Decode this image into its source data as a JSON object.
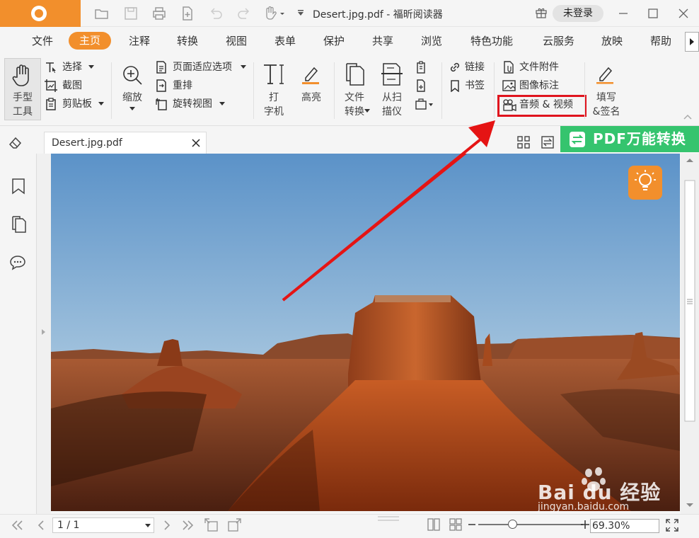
{
  "app": {
    "doc_title": "Desert.jpg.pdf - 福昕阅读器",
    "login_label": "未登录"
  },
  "menu": {
    "items": [
      "文件",
      "主页",
      "注释",
      "转换",
      "视图",
      "表单",
      "保护",
      "共享",
      "浏览",
      "特色功能",
      "云服务",
      "放映",
      "帮助"
    ],
    "active": "主页"
  },
  "ribbon": {
    "hand_tool": "手型\n工具",
    "select": "选择",
    "snapshot": "截图",
    "clipboard": "剪贴板",
    "zoom": "缩放",
    "fit_page": "页面适应选项",
    "reflow": "重排",
    "rotate_view": "旋转视图",
    "typewriter": "打\n字机",
    "highlight": "高亮",
    "file_convert": "文件\n转换",
    "from_scanner": "从扫\n描仪",
    "link": "链接",
    "bookmark": "书签",
    "file_attachment": "文件附件",
    "image_annotation": "图像标注",
    "audio_video": "音频 & 视频",
    "fill_sign": "填写\n&签名"
  },
  "tab": {
    "doc_name": "Desert.jpg.pdf"
  },
  "promo": {
    "pdf_convert": "PDF万能转换"
  },
  "status": {
    "page": "1 / 1",
    "zoom": "69.30%"
  },
  "watermark": {
    "brand": "Bai du 经验",
    "url": "jingyan.baidu.com"
  },
  "colors": {
    "accent": "#f28f2c",
    "convert_green": "#35c46e",
    "highlight_red": "#e0141e"
  }
}
